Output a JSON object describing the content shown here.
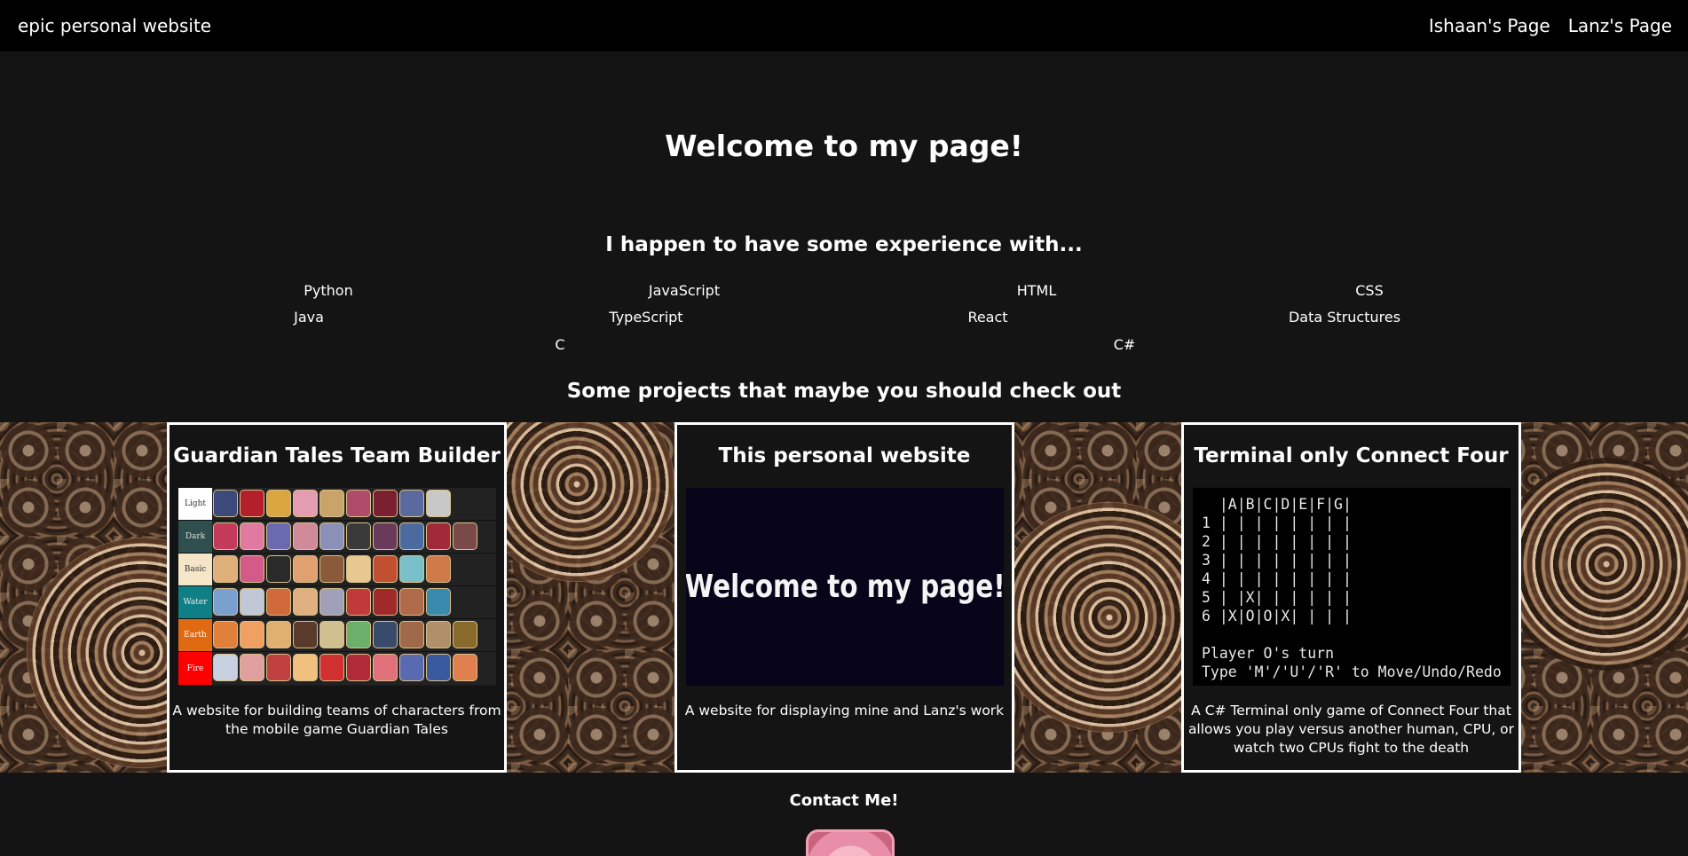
{
  "nav": {
    "brand": "epic personal website",
    "links": [
      "Ishaan's Page",
      "Lanz's Page"
    ]
  },
  "hero": {
    "title": "Welcome to my page!"
  },
  "experience": {
    "heading": "I happen to have some experience with...",
    "skills": [
      "Python",
      "JavaScript",
      "HTML",
      "CSS",
      "Java",
      "TypeScript",
      "React",
      "Data Structures",
      "C",
      "C#"
    ]
  },
  "projects": {
    "heading": "Some projects that maybe you should check out",
    "cards": [
      {
        "title": "Guardian Tales Team Builder",
        "description": "A website for building teams of characters from the mobile game Guardian Tales",
        "tiers": [
          "Light",
          "Dark",
          "Basic",
          "Water",
          "Earth",
          "Fire"
        ]
      },
      {
        "title": "This personal website",
        "description": "A website for displaying mine and Lanz's work",
        "screenshot_text": "Welcome to my page!"
      },
      {
        "title": "Terminal only Connect Four",
        "description": "A C# Terminal only game of Connect Four that allows you play versus another human, CPU, or watch two CPUs fight to the death",
        "terminal_lines": [
          "  |A|B|C|D|E|F|G|",
          "1 | | | | | | | |",
          "2 | | | | | | | |",
          "3 | | | | | | | |",
          "4 | | | | | | | |",
          "5 | |X| | | | | |",
          "6 |X|O|O|X| | | |",
          "",
          "Player O's turn",
          "Type 'M'/'U'/'R' to Move/Undo/Redo"
        ]
      }
    ]
  },
  "contact": {
    "heading": "Contact Me!"
  },
  "colors": {
    "nav_bg": "#000000",
    "page_bg": "#141414",
    "card_border": "#ffffff",
    "tier_light": "#ffffff",
    "tier_dark": "#2f4f4f",
    "tier_basic": "#f5e6c8",
    "tier_water": "#0f7f86",
    "tier_earth": "#e06a12",
    "tier_fire": "#ff0000"
  }
}
